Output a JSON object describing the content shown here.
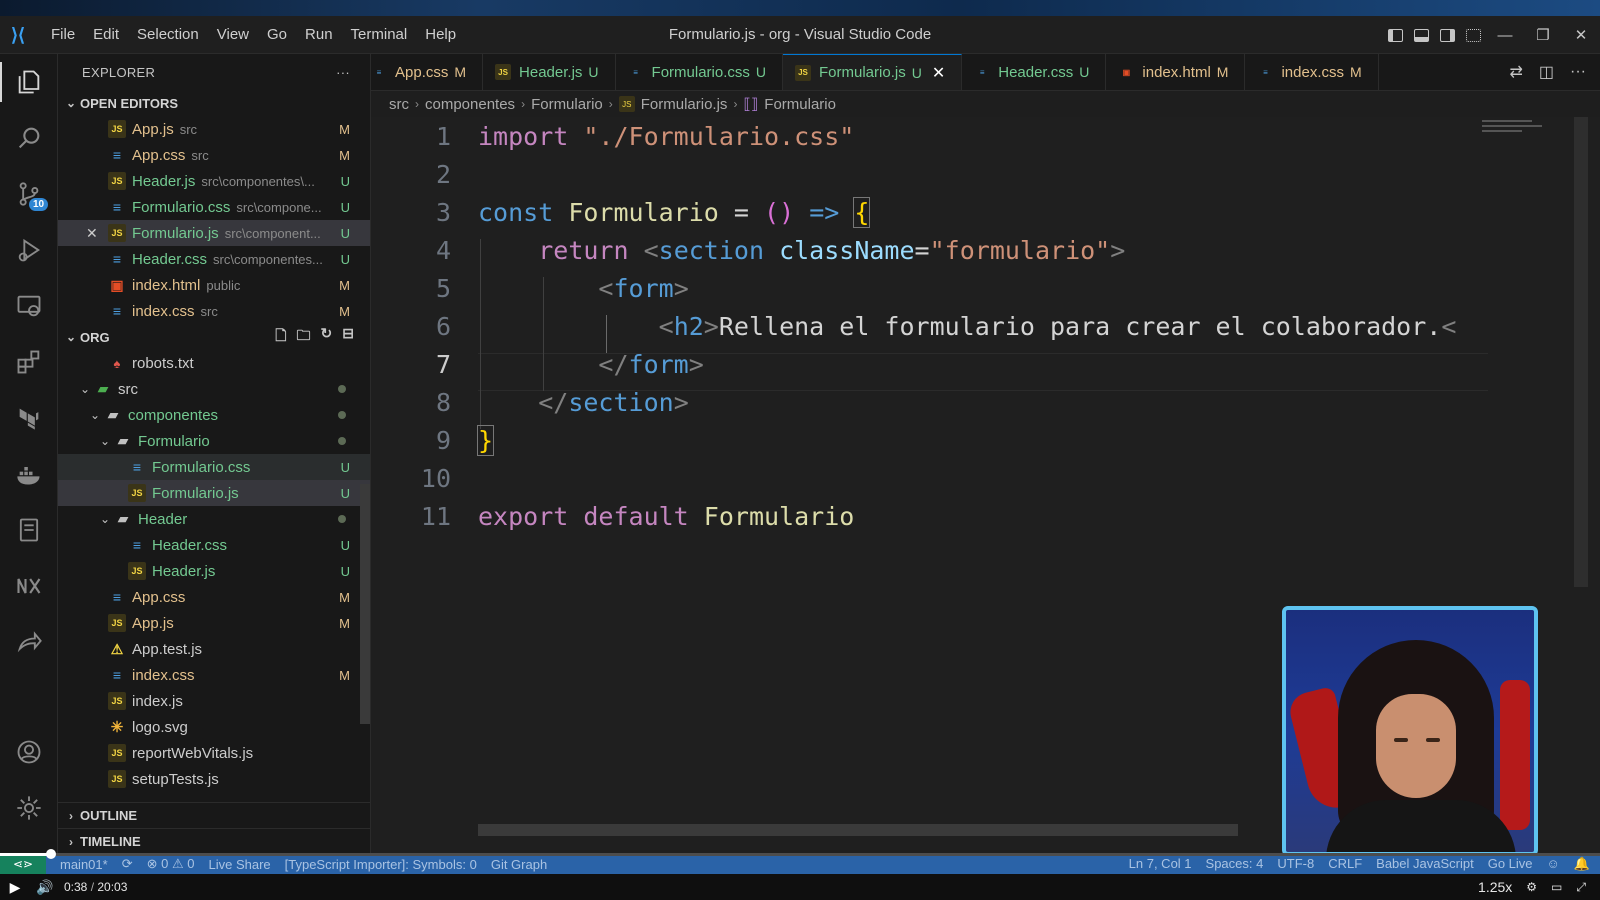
{
  "titlebar": {
    "menu": [
      "File",
      "Edit",
      "Selection",
      "View",
      "Go",
      "Run",
      "Terminal",
      "Help"
    ],
    "window_title": "Formulario.js - org - Visual Studio Code"
  },
  "activitybar": {
    "source_control_badge": "10"
  },
  "sidebar": {
    "title": "EXPLORER",
    "open_editors_title": "OPEN EDITORS",
    "open_editors": [
      {
        "name": "App.js",
        "desc": "src",
        "status": "M",
        "type": "js"
      },
      {
        "name": "App.css",
        "desc": "src",
        "status": "M",
        "type": "css"
      },
      {
        "name": "Header.js",
        "desc": "src\\componentes\\...",
        "status": "U",
        "type": "js"
      },
      {
        "name": "Formulario.css",
        "desc": "src\\compone...",
        "status": "U",
        "type": "css"
      },
      {
        "name": "Formulario.js",
        "desc": "src\\component...",
        "status": "U",
        "type": "js"
      },
      {
        "name": "Header.css",
        "desc": "src\\componentes...",
        "status": "U",
        "type": "css"
      },
      {
        "name": "index.html",
        "desc": "public",
        "status": "M",
        "type": "html"
      },
      {
        "name": "index.css",
        "desc": "src",
        "status": "M",
        "type": "css"
      }
    ],
    "org_title": "ORG",
    "tree": [
      {
        "name": "robots.txt"
      },
      {
        "name": "src"
      },
      {
        "name": "componentes"
      },
      {
        "name": "Formulario"
      },
      {
        "name": "Formulario.css",
        "status": "U"
      },
      {
        "name": "Formulario.js",
        "status": "U"
      },
      {
        "name": "Header"
      },
      {
        "name": "Header.css",
        "status": "U"
      },
      {
        "name": "Header.js",
        "status": "U"
      },
      {
        "name": "App.css",
        "status": "M"
      },
      {
        "name": "App.js",
        "status": "M"
      },
      {
        "name": "App.test.js"
      },
      {
        "name": "index.css",
        "status": "M"
      },
      {
        "name": "index.js"
      },
      {
        "name": "logo.svg"
      },
      {
        "name": "reportWebVitals.js"
      },
      {
        "name": "setupTests.js"
      }
    ],
    "outline_title": "OUTLINE",
    "timeline_title": "TIMELINE"
  },
  "tabs": [
    {
      "label": "App.css",
      "status": "M",
      "type": "css"
    },
    {
      "label": "Header.js",
      "status": "U",
      "type": "js"
    },
    {
      "label": "Formulario.css",
      "status": "U",
      "type": "css"
    },
    {
      "label": "Formulario.js",
      "status": "U",
      "type": "js",
      "active": true
    },
    {
      "label": "Header.css",
      "status": "U",
      "type": "css"
    },
    {
      "label": "index.html",
      "status": "M",
      "type": "html"
    },
    {
      "label": "index.css",
      "status": "M",
      "type": "css"
    }
  ],
  "breadcrumb": [
    "src",
    "componentes",
    "Formulario",
    "Formulario.js",
    "Formulario"
  ],
  "editor": {
    "current_line": 7,
    "lines": [
      {
        "n": "1",
        "text": "import \"./Formulario.css\""
      },
      {
        "n": "2",
        "text": ""
      },
      {
        "n": "3",
        "text": "const Formulario = () => {"
      },
      {
        "n": "4",
        "text": "    return <section className=\"formulario\">"
      },
      {
        "n": "5",
        "text": "        <form>"
      },
      {
        "n": "6",
        "text": "            <h2>Rellena el formulario para crear el colaborador.<"
      },
      {
        "n": "7",
        "text": "        </form>"
      },
      {
        "n": "8",
        "text": "    </section>"
      },
      {
        "n": "9",
        "text": "}"
      },
      {
        "n": "10",
        "text": ""
      },
      {
        "n": "11",
        "text": "export default Formulario"
      }
    ]
  },
  "statusbar": {
    "branch": "main01*",
    "errors": "0",
    "warnings": "0",
    "live_share": "Live Share",
    "ts_importer": "[TypeScript Importer]: Symbols: 0",
    "git_graph": "Git Graph",
    "position": "Ln 7, Col 1",
    "spaces": "Spaces: 4",
    "encoding": "UTF-8",
    "eol": "CRLF",
    "language": "Babel JavaScript",
    "go_live": "Go Live"
  },
  "player": {
    "current_time": "0:38",
    "duration": "20:03",
    "speed": "1.25x",
    "progress_fraction": 0.0316
  }
}
